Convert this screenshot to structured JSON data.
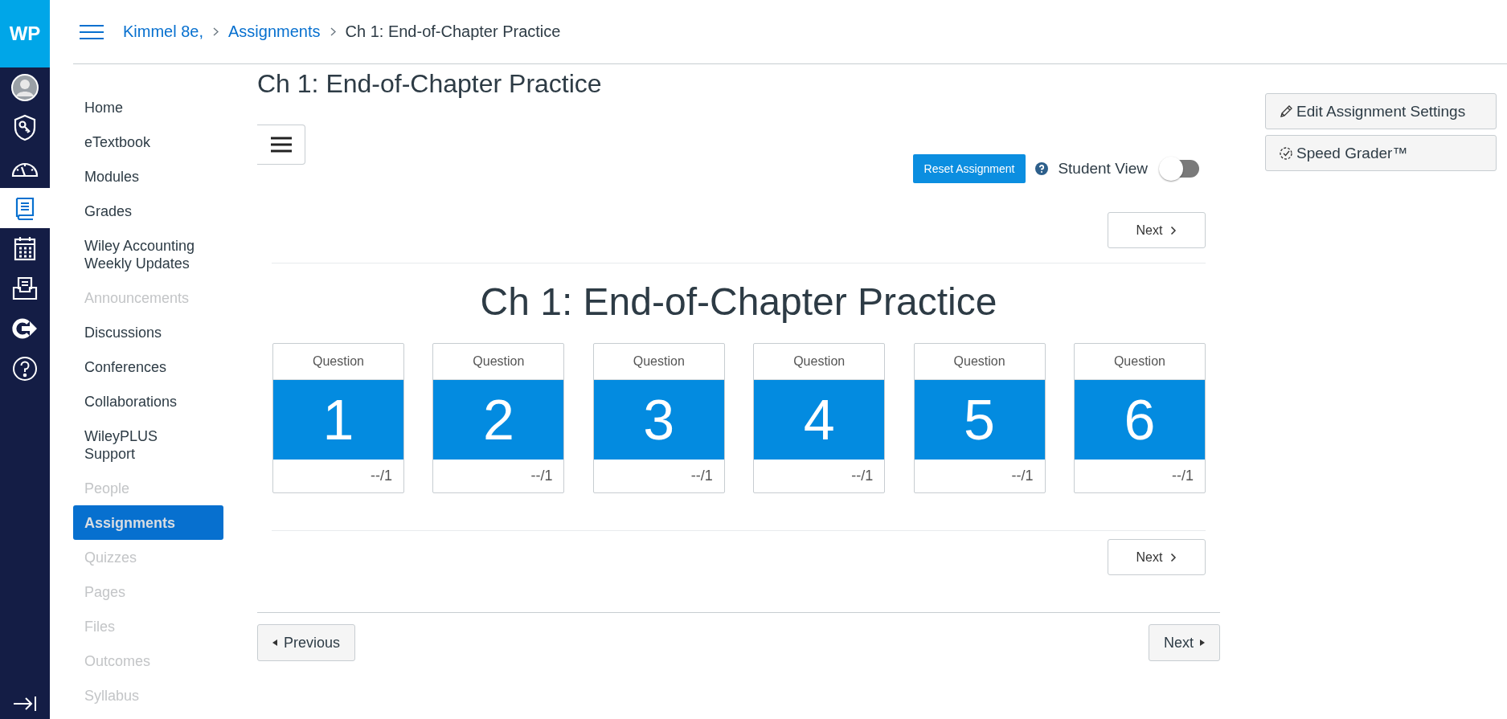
{
  "logo": "WP",
  "rail": [
    {
      "kind": "account",
      "selected": false
    },
    {
      "kind": "admin",
      "selected": false
    },
    {
      "kind": "dashboard",
      "selected": false
    },
    {
      "kind": "courses",
      "selected": true
    },
    {
      "kind": "calendar",
      "selected": false
    },
    {
      "kind": "inbox",
      "selected": false
    },
    {
      "kind": "commons",
      "selected": false
    },
    {
      "kind": "help",
      "selected": false
    }
  ],
  "breadcrumbs": [
    "Kimmel 8e,",
    "Assignments",
    "Ch 1: End-of-Chapter Practice"
  ],
  "course_nav": [
    {
      "label": "Home",
      "disabled": false,
      "selected": false
    },
    {
      "label": "eTextbook",
      "disabled": false,
      "selected": false
    },
    {
      "label": "Modules",
      "disabled": false,
      "selected": false
    },
    {
      "label": "Grades",
      "disabled": false,
      "selected": false
    },
    {
      "label": "Wiley Accounting Weekly Updates",
      "disabled": false,
      "selected": false
    },
    {
      "label": "Announcements",
      "disabled": true,
      "selected": false
    },
    {
      "label": "Discussions",
      "disabled": false,
      "selected": false
    },
    {
      "label": "Conferences",
      "disabled": false,
      "selected": false
    },
    {
      "label": "Collaborations",
      "disabled": false,
      "selected": false
    },
    {
      "label": "WileyPLUS Support",
      "disabled": false,
      "selected": false
    },
    {
      "label": "People",
      "disabled": true,
      "selected": false
    },
    {
      "label": "Assignments",
      "disabled": false,
      "selected": true
    },
    {
      "label": "Quizzes",
      "disabled": true,
      "selected": false
    },
    {
      "label": "Pages",
      "disabled": true,
      "selected": false
    },
    {
      "label": "Files",
      "disabled": true,
      "selected": false
    },
    {
      "label": "Outcomes",
      "disabled": true,
      "selected": false
    },
    {
      "label": "Syllabus",
      "disabled": true,
      "selected": false
    }
  ],
  "page_title": "Ch 1: End-of-Chapter Practice",
  "reset_button": "Reset Assignment",
  "student_view": {
    "label": "Student View",
    "on": false
  },
  "next_top": "Next",
  "assignment_title": "Ch 1: End-of-Chapter Practice",
  "questions": [
    {
      "label": "Question",
      "number": "1",
      "score": "--/1"
    },
    {
      "label": "Question",
      "number": "2",
      "score": "--/1"
    },
    {
      "label": "Question",
      "number": "3",
      "score": "--/1"
    },
    {
      "label": "Question",
      "number": "4",
      "score": "--/1"
    },
    {
      "label": "Question",
      "number": "5",
      "score": "--/1"
    },
    {
      "label": "Question",
      "number": "6",
      "score": "--/1"
    }
  ],
  "next_bottom": "Next",
  "previous_button": "Previous",
  "next_button": "Next",
  "sidebar_buttons": [
    {
      "kind": "edit",
      "label": "Edit Assignment Settings"
    },
    {
      "kind": "grader",
      "label": "Speed Grader™"
    }
  ]
}
